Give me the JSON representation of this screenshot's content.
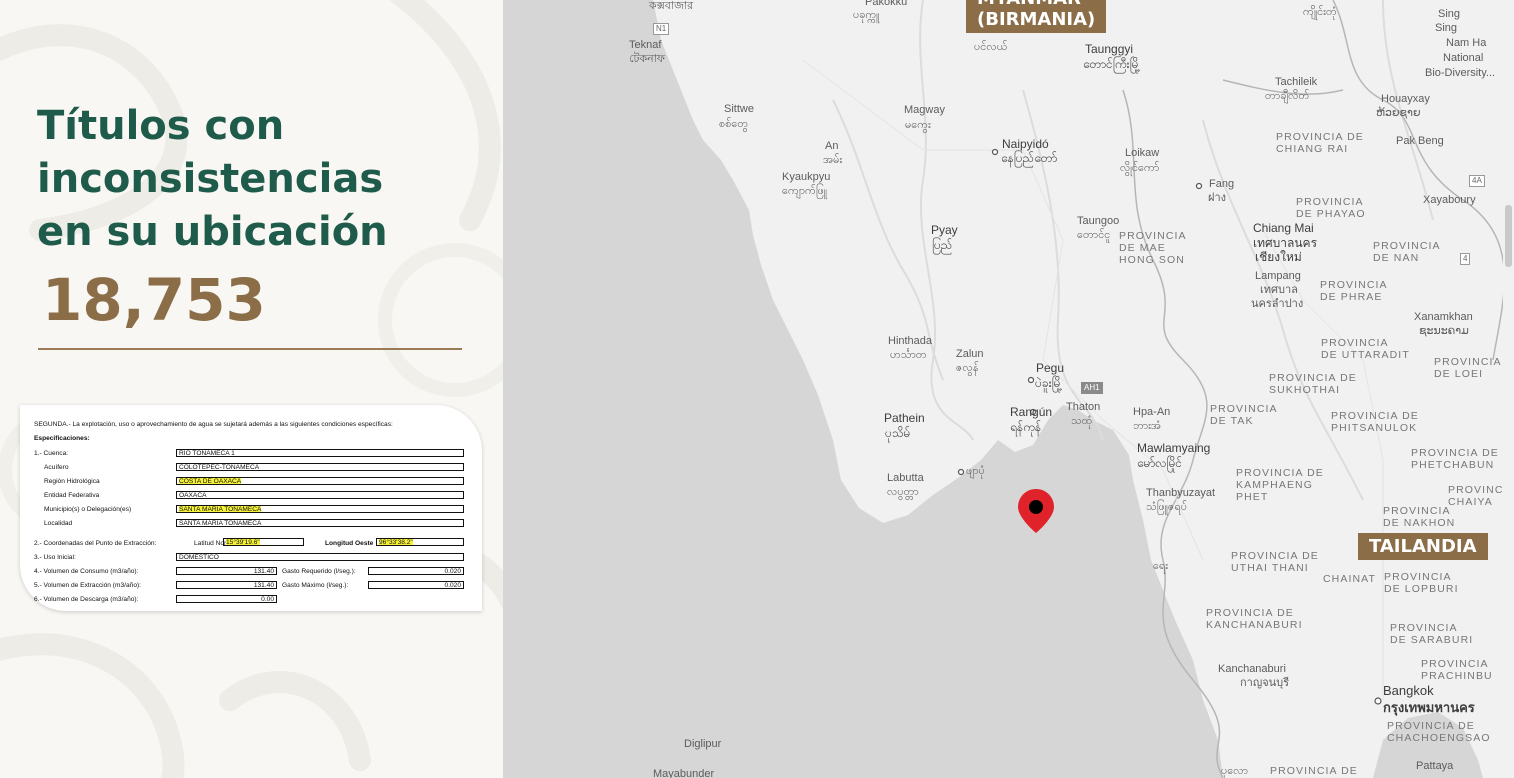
{
  "panel": {
    "title_lines": [
      "Títulos  con",
      "inconsistencias",
      "en su ubicación"
    ],
    "count": "18,753"
  },
  "document": {
    "heading": "SEGUNDA.- La explotación, uso o aprovechamiento de agua se sujetará además a las siguientes condiciones específicas:",
    "section": "Especificaciones:",
    "cuenca_label": "1.- Cuenca:",
    "cuenca_value": "RIO TONAMECA 1",
    "acuifero_label": "Acuífero",
    "acuifero_value": "COLOTEPEC-TONAMECA",
    "region_label": "Región Hidrológica",
    "region_value": "COSTA DE OAXACA",
    "entidad_label": "Entidad Federativa",
    "entidad_value": "OAXACA",
    "municipio_label": "Municipio(s) o Delegación(es)",
    "municipio_value": "SANTA MARIA TONAMECA",
    "localidad_label": "Localidad",
    "localidad_value": "SANTA MARIA TONAMECA",
    "coords_label": "2.- Coordenadas del Punto de Extracción:",
    "lat_label": "Latitud Norte",
    "lat_value": "15°39'19.6\"",
    "lon_label": "Longitud Oeste",
    "lon_value": "96°33'38.2\"",
    "uso_label": "3.- Uso Inicial:",
    "uso_value": "DOMESTICO",
    "consumo_label": "4.- Volumen de Consumo (m3/año):",
    "consumo_value": "131.40",
    "gasto_req_label": "Gasto Requerido (l/seg.):",
    "gasto_req_value": "0.020",
    "extraccion_label": "5.- Volumen de Extracción (m3/año):",
    "extraccion_value": "131.40",
    "gasto_max_label": "Gasto Máximo (l/seg.):",
    "gasto_max_value": "0.020",
    "descarga_label": "6.- Volumen de Descarga (m3/año):",
    "descarga_value": "0.00"
  },
  "map": {
    "country_top_1": "MYANMAR",
    "country_top_2": "(BIRMANIA)",
    "country_right": "TAILANDIA",
    "places": {
      "cox": "কক্সবাজার",
      "pakokku": "Pakokku",
      "pakokku_my": "ပခုက္ကူ",
      "n1": "N1",
      "teknaf": "Teknaf",
      "teknaf_bn": "টেকনাফ",
      "taunggyi": "Taunggyi",
      "taunggyi_my": "တောင်ကြီးမြို့",
      "kengtung_my": "ကျိုင်းတုံ",
      "sing": "Sing",
      "namha": "Nam Ha",
      "national": "National",
      "biodiv": "Bio-Diversity...",
      "tachileik": "Tachileik",
      "tachileik_my": "တာချီလိတ်",
      "houayxay": "Houayxay",
      "houayxay_lo": "ຫ້ວຍຊາຍ",
      "sittwe": "Sittwe",
      "sittwe_my": "စစ်တွေ",
      "magway": "Magway",
      "magway_my": "မကွေး",
      "amhe": "An",
      "amhe_my": "အမ်း",
      "naypyidaw": "Naipyidó",
      "naypyidaw_my": "နေပြည်တော်",
      "loikaw": "Loikaw",
      "loikaw_my": "လွိုင်ကော်",
      "kyaukpyu": "Kyaukpyu",
      "kyaukpyu_my": "ကျောက်ဖြူ",
      "pyay": "Pyay",
      "pyay_my": "ပြည်",
      "taungoo": "Taungoo",
      "taungoo_my": "တောင်ငူ",
      "fang": "Fang",
      "fang_th": "ฝาง",
      "chiangmai": "Chiang Mai",
      "chiangmai_th1": "เทศบาลนคร",
      "chiangmai_th2": "เชียงใหม่",
      "lampang": "Lampang",
      "lampang_th1": "เทศบาล",
      "lampang_th2": "นครลำปาง",
      "pakbeng": "Pak Beng",
      "xayaboury": "Xayaboury",
      "xanamkhan": "Xanamkhan",
      "xanamkhan_lo": "ຊະນະຄາມ",
      "hinthada": "Hinthada",
      "hinthada_my": "ဟင်္သာတ",
      "zalun": "Zalun",
      "zalun_my": "ဇလွန်",
      "pegu": "Pegu",
      "pegu_my": "ပဲခူးမြို့",
      "ah1": "AH1",
      "pathein": "Pathein",
      "pathein_my": "ပုသိမ်",
      "rangun": "Rangún",
      "rangun_my": "ရန်ကုန်",
      "thaton": "Thaton",
      "thaton_my": "သထုံ",
      "hpaan": "Hpa-An",
      "hpaan_my": "ဘားအံ",
      "mawlamyaing": "Mawlamyaing",
      "mawlamyaing_my": "မော်လမြိုင်",
      "labutta": "Labutta",
      "labutta_my": "လပွတ္တာ",
      "pyapon_my": "ဖျာပုံ",
      "thanbyuzayat": "Thanbyuzayat",
      "thanbyuzayat_my": "သံဖြူဇရပ်",
      "ye_my": "ရေး",
      "kanchanaburi": "Kanchanaburi",
      "kanchanaburi_th": "กาญจนบุรี",
      "bangkok": "Bangkok",
      "bangkok_th": "กรุงเทพมหานคร",
      "diglipur": "Diglipur",
      "mayabunder": "Mayabunder",
      "pattaya": "Pattaya",
      "bottom_my": "ပုလော"
    },
    "provinces": {
      "chiangrai": [
        "PROVINCIA DE",
        "CHIANG RAI"
      ],
      "phayao": [
        "PROVINCIA",
        "DE PHAYAO"
      ],
      "maehongson": [
        "PROVINCIA",
        "DE MAE",
        "HONG SON"
      ],
      "nan": [
        "PROVINCIA",
        "DE NAN"
      ],
      "phrae": [
        "PROVINCIA",
        "DE PHRAE"
      ],
      "uttaradit": [
        "PROVINCIA",
        "DE UTTARADIT"
      ],
      "loei": [
        "PROVINCIA",
        "DE LOEI"
      ],
      "sukhothai": [
        "PROVINCIA DE",
        "SUKHOTHAI"
      ],
      "tak": [
        "PROVINCIA",
        "DE TAK"
      ],
      "phitsanulok": [
        "PROVINCIA DE",
        "PHITSANULOK"
      ],
      "phetchabun": [
        "PROVINCIA DE",
        "PHETCHABUN"
      ],
      "kamphaeng": [
        "PROVINCIA DE",
        "KAMPHAENG",
        "PHET"
      ],
      "nakhon": [
        "PROVINCIA",
        "DE NAKHON"
      ],
      "chaiyaphum": [
        "PROVINCIA",
        "CHAIYA"
      ],
      "uthai": [
        "PROVINCIA DE",
        "UTHAI THANI"
      ],
      "chainat": [
        "CHAINAT"
      ],
      "lopburi": [
        "PROVINCIA",
        "DE LOPBURI"
      ],
      "kanchanaburi": [
        "PROVINCIA DE",
        "KANCHANABURI"
      ],
      "saraburi": [
        "PROVINCIA",
        "DE SARABURI"
      ],
      "prachinburi": [
        "PROVINCIA",
        "PRACHINBU"
      ],
      "chacho": [
        "PROVINCIA DE",
        "CHACHOENGSAO"
      ],
      "bottom": [
        "PROVINCIA DE"
      ]
    },
    "route_badges": [
      "4A",
      "4"
    ]
  },
  "colors": {
    "title": "#1f5b4b",
    "accent": "#8b6d47",
    "pin": "#e0222b"
  }
}
